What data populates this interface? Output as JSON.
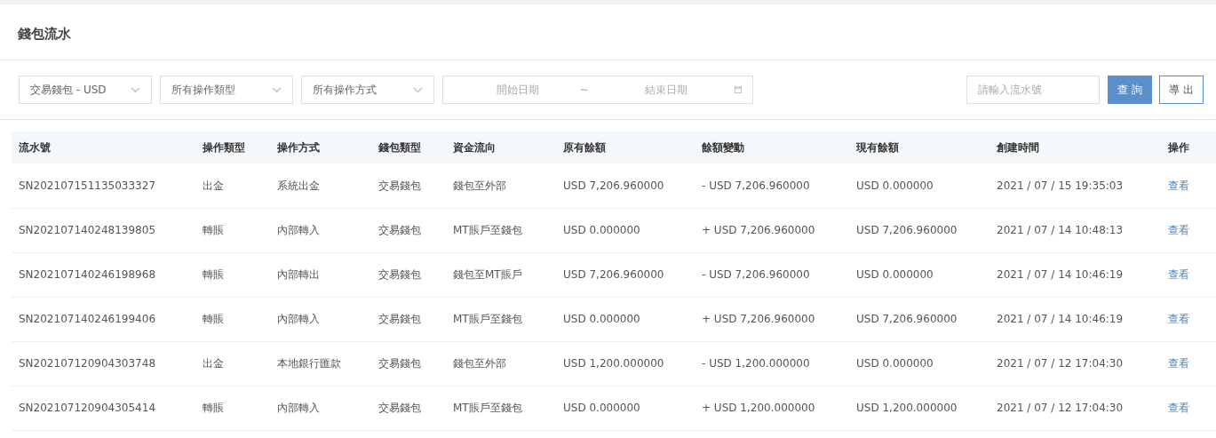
{
  "page_title": "錢包流水",
  "filters": {
    "selects": [
      {
        "value": "交易錢包 - USD"
      },
      {
        "value": "所有操作類型"
      },
      {
        "value": "所有操作方式"
      }
    ],
    "date_range": {
      "start_placeholder": "開始日期",
      "separator": "~",
      "end_placeholder": "結束日期"
    },
    "search": {
      "placeholder": "請輸入流水號"
    },
    "buttons": [
      {
        "label": "查 詢",
        "kind": "primary"
      },
      {
        "label": "導 出",
        "kind": "outline"
      }
    ]
  },
  "table": {
    "columns": [
      "流水號",
      "操作類型",
      "操作方式",
      "錢包類型",
      "資金流向",
      "原有餘額",
      "餘額變動",
      "現有餘額",
      "創建時間",
      "操作"
    ],
    "rows": [
      {
        "cells": [
          "SN202107151135033327",
          "出金",
          "系統出金",
          "交易錢包",
          "錢包至外部",
          "USD 7,206.960000",
          "- USD 7,206.960000",
          "USD 0.000000",
          "2021 / 07 / 15 19:35:03"
        ],
        "action": "查看"
      },
      {
        "cells": [
          "SN202107140248139805",
          "轉賬",
          "內部轉入",
          "交易錢包",
          "MT賬戶至錢包",
          "USD 0.000000",
          "+ USD 7,206.960000",
          "USD 7,206.960000",
          "2021 / 07 / 14 10:48:13"
        ],
        "action": "查看"
      },
      {
        "cells": [
          "SN202107140246198968",
          "轉賬",
          "內部轉出",
          "交易錢包",
          "錢包至MT賬戶",
          "USD 7,206.960000",
          "- USD 7,206.960000",
          "USD 0.000000",
          "2021 / 07 / 14 10:46:19"
        ],
        "action": "查看"
      },
      {
        "cells": [
          "SN202107140246199406",
          "轉賬",
          "內部轉入",
          "交易錢包",
          "MT賬戶至錢包",
          "USD 0.000000",
          "+ USD 7,206.960000",
          "USD 7,206.960000",
          "2021 / 07 / 14 10:46:19"
        ],
        "action": "查看"
      },
      {
        "cells": [
          "SN202107120904303748",
          "出金",
          "本地銀行匯款",
          "交易錢包",
          "錢包至外部",
          "USD 1,200.000000",
          "- USD 1,200.000000",
          "USD 0.000000",
          "2021 / 07 / 12 17:04:30"
        ],
        "action": "查看"
      },
      {
        "cells": [
          "SN202107120904305414",
          "轉賬",
          "內部轉入",
          "交易錢包",
          "MT賬戶至錢包",
          "USD 0.000000",
          "+ USD 1,200.000000",
          "USD 1,200.000000",
          "2021 / 07 / 12 17:04:30"
        ],
        "action": "查看"
      }
    ]
  }
}
